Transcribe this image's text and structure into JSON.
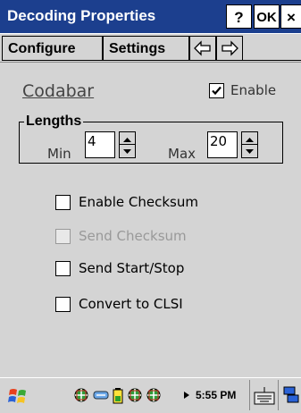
{
  "window": {
    "title": "Decoding Properties",
    "help_label": "?",
    "ok_label": "OK",
    "close_label": "×"
  },
  "tabs": {
    "configure": "Configure",
    "settings": "Settings"
  },
  "symbology": {
    "name": "Codabar",
    "enable_label": "Enable",
    "enable_checked": true
  },
  "lengths": {
    "group_title": "Lengths",
    "min_label": "Min",
    "min_value": "4",
    "max_label": "Max",
    "max_value": "20"
  },
  "options": [
    {
      "label": "Enable Checksum",
      "checked": false,
      "disabled": false
    },
    {
      "label": "Send Checksum",
      "checked": false,
      "disabled": true
    },
    {
      "label": "Send Start/Stop",
      "checked": false,
      "disabled": false
    },
    {
      "label": "Convert to CLSI",
      "checked": false,
      "disabled": false
    }
  ],
  "taskbar": {
    "time": "5:55 PM"
  },
  "colors": {
    "titlebar": "#1c3f8e",
    "background": "#d4d4d4"
  }
}
